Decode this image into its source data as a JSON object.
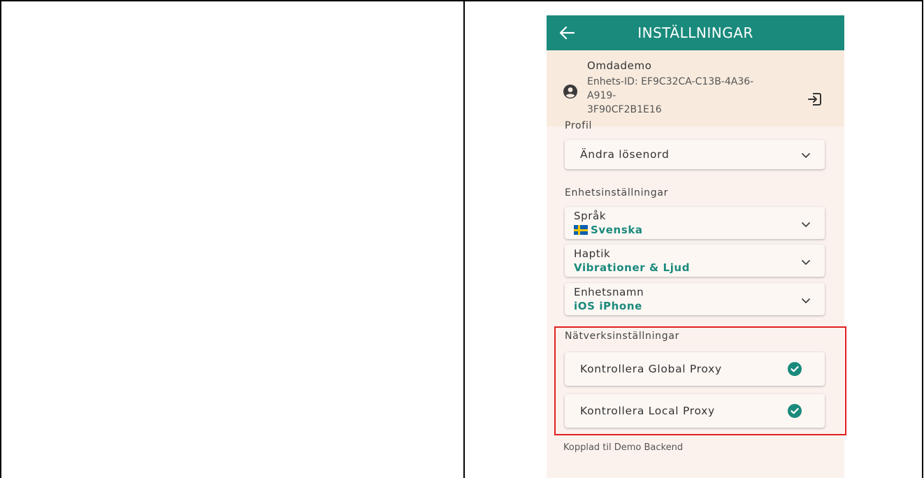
{
  "header": {
    "title": "INSTÄLLNINGAR"
  },
  "account": {
    "name": "Omdademo",
    "device_id_line1": "Enhets-ID: EF9C32CA-C13B-4A36-A919-",
    "device_id_line2": "3F90CF2B1E16"
  },
  "profile": {
    "section_label": "Profil",
    "change_password_label": "Ändra lösenord"
  },
  "device_settings": {
    "section_label": "Enhetsinställningar",
    "items": [
      {
        "label": "Språk",
        "value": "Svenska"
      },
      {
        "label": "Haptik",
        "value": "Vibrationer & Ljud"
      },
      {
        "label": "Enhetsnamn",
        "value": "iOS iPhone"
      }
    ]
  },
  "network_settings": {
    "section_label": "Nätverksinställningar",
    "items": [
      {
        "label": "Kontrollera Global Proxy",
        "status": "checked"
      },
      {
        "label": "Kontrollera Local Proxy",
        "status": "checked"
      }
    ]
  },
  "footer": {
    "connection_text": "Kopplad til Demo Backend"
  },
  "colors": {
    "primary": "#1a8a7c",
    "account_bg": "#f8ebde",
    "page_bg": "#fbf2ee",
    "highlight": "#e02020"
  }
}
